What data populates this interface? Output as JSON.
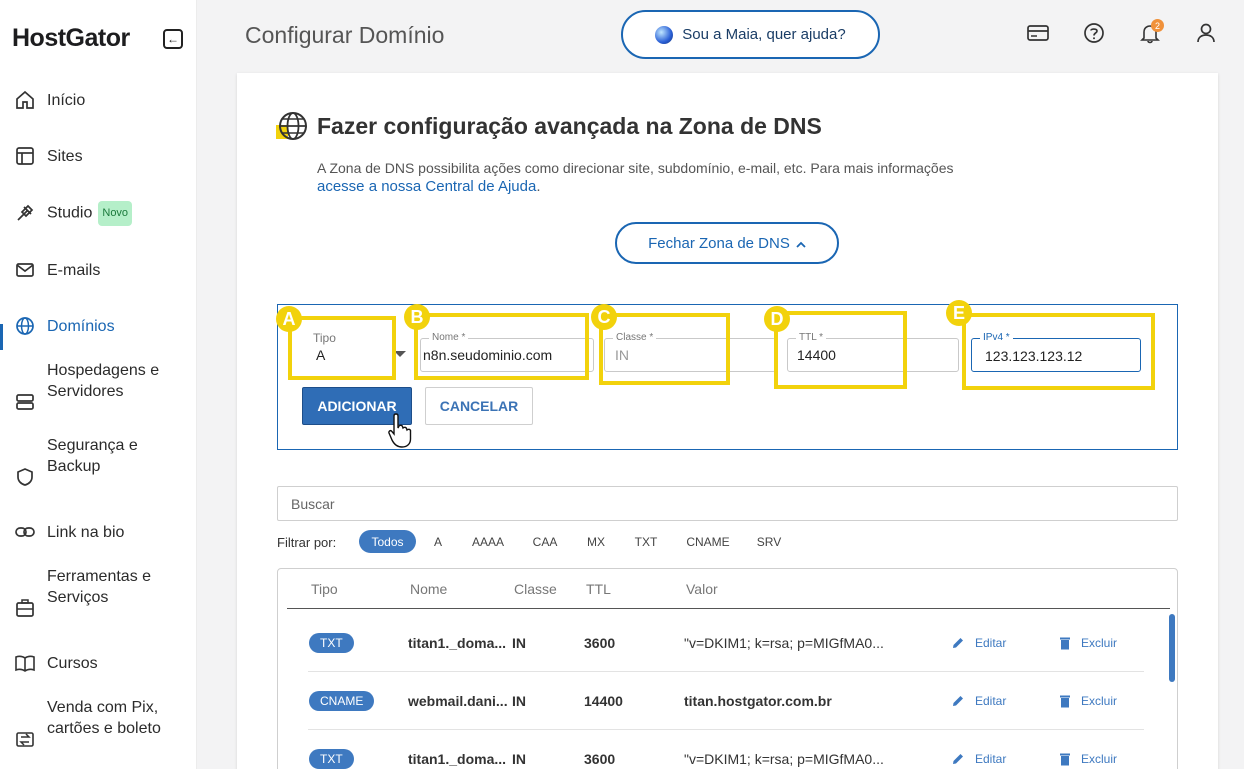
{
  "brand": {
    "logo_text": "HostGator",
    "accent": "#1a66b3",
    "highlight": "#f2d20c"
  },
  "sidebar": {
    "items": [
      {
        "label": "Início",
        "icon": "home-icon"
      },
      {
        "label": "Sites",
        "icon": "layout-icon"
      },
      {
        "label": "Studio",
        "icon": "studio-icon",
        "badge": "Novo"
      },
      {
        "label": "E-mails",
        "icon": "mail-icon"
      },
      {
        "label": "Domínios",
        "icon": "globe-icon",
        "active": true
      },
      {
        "label": "Hospedagens e Servidores",
        "icon": "server-icon"
      },
      {
        "label": "Segurança e Backup",
        "icon": "shield-icon"
      },
      {
        "label": "Link na bio",
        "icon": "link-icon"
      },
      {
        "label": "Ferramentas e Serviços",
        "icon": "tools-icon"
      },
      {
        "label": "Cursos",
        "icon": "book-icon"
      },
      {
        "label": "Venda com Pix, cartões e boleto",
        "icon": "payment-icon"
      }
    ]
  },
  "header": {
    "title": "Configurar Domínio",
    "maia_label": "Sou a Maia, quer ajuda?",
    "notification_count": "2"
  },
  "dns_section": {
    "title": "Fazer configuração avançada na Zona de DNS",
    "description": "A Zona de DNS possibilita ações como direcionar site, subdomínio, e-mail, etc. Para mais informações",
    "help_link": "acesse a nossa Central de Ajuda",
    "help_link_suffix": ".",
    "close_button": "Fechar Zona de DNS"
  },
  "record_form": {
    "markers": [
      "A",
      "B",
      "C",
      "D",
      "E"
    ],
    "tipo": {
      "label": "Tipo",
      "value": "A"
    },
    "nome": {
      "label": "Nome *",
      "value": "n8n.seudominio.com"
    },
    "classe": {
      "label": "Classe *",
      "value": "IN"
    },
    "ttl": {
      "label": "TTL *",
      "value": "14400"
    },
    "ipv4": {
      "label": "IPv4 *",
      "value": "123.123.123.12"
    },
    "add_button": "ADICIONAR",
    "cancel_button": "CANCELAR"
  },
  "search": {
    "placeholder": "Buscar"
  },
  "filters": {
    "label": "Filtrar por:",
    "options": [
      "Todos",
      "A",
      "AAAA",
      "CAA",
      "MX",
      "TXT",
      "CNAME",
      "SRV"
    ],
    "selected": "Todos"
  },
  "records_table": {
    "headers": [
      "Tipo",
      "Nome",
      "Classe",
      "TTL",
      "Valor"
    ],
    "edit_label": "Editar",
    "delete_label": "Excluir",
    "rows": [
      {
        "type": "TXT",
        "name": "titan1._doma...",
        "class": "IN",
        "ttl": "3600",
        "value": "\"v=DKIM1; k=rsa; p=MIGfMA0..."
      },
      {
        "type": "CNAME",
        "name": "webmail.dani...",
        "class": "IN",
        "ttl": "14400",
        "value": "titan.hostgator.com.br"
      },
      {
        "type": "TXT",
        "name": "titan1._doma...",
        "class": "IN",
        "ttl": "3600",
        "value": "\"v=DKIM1; k=rsa; p=MIGfMA0..."
      }
    ]
  }
}
